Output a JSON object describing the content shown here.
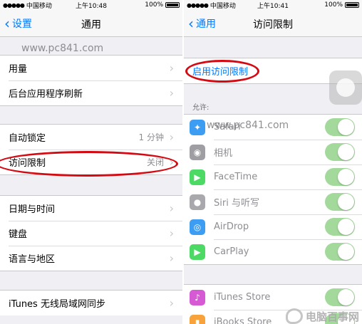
{
  "left": {
    "status": {
      "carrier": "中国移动",
      "time": "上午10:48",
      "battery": "100%"
    },
    "nav": {
      "back_label": "设置",
      "title": "通用"
    },
    "watermark": "www.pc841.com",
    "group1": [
      {
        "label": "用量"
      },
      {
        "label": "后台应用程序刷新"
      }
    ],
    "group2": [
      {
        "label": "自动锁定",
        "detail": "1 分钟"
      },
      {
        "label": "访问限制",
        "detail": "关闭"
      }
    ],
    "group3": [
      {
        "label": "日期与时间"
      },
      {
        "label": "键盘"
      },
      {
        "label": "语言与地区"
      }
    ],
    "group4": [
      {
        "label": "iTunes 无线局域网同步"
      }
    ]
  },
  "right": {
    "status": {
      "carrier": "中国移动",
      "time": "上午10:41",
      "battery": "100%"
    },
    "nav": {
      "back_label": "通用",
      "title": "访问限制"
    },
    "enable_label": "启用访问限制",
    "section_label": "允许:",
    "watermark": "www.pc841.com",
    "apps": [
      {
        "label": "Safari",
        "icon": "safari-icon",
        "color": "#3d9df2",
        "on": true
      },
      {
        "label": "相机",
        "icon": "camera-icon",
        "color": "#9e9ea3",
        "on": true
      },
      {
        "label": "FaceTime",
        "icon": "facetime-icon",
        "color": "#4cd964",
        "on": true
      },
      {
        "label": "Siri 与听写",
        "icon": "microphone-icon",
        "color": "#a8a8ad",
        "on": true
      },
      {
        "label": "AirDrop",
        "icon": "airdrop-icon",
        "color": "#3d9df2",
        "on": true
      },
      {
        "label": "CarPlay",
        "icon": "carplay-icon",
        "color": "#4cd964",
        "on": true
      }
    ],
    "apps2": [
      {
        "label": "iTunes Store",
        "icon": "itunes-icon",
        "color": "#d65ad3",
        "on": true
      },
      {
        "label": "iBooks Store",
        "icon": "ibooks-icon",
        "color": "#f7a23b",
        "on": true
      }
    ],
    "brand_text": "电脑百事网"
  },
  "colors": {
    "accent": "#007aff",
    "switch_on": "#4cd964",
    "highlight_oval": "#d40a12"
  }
}
